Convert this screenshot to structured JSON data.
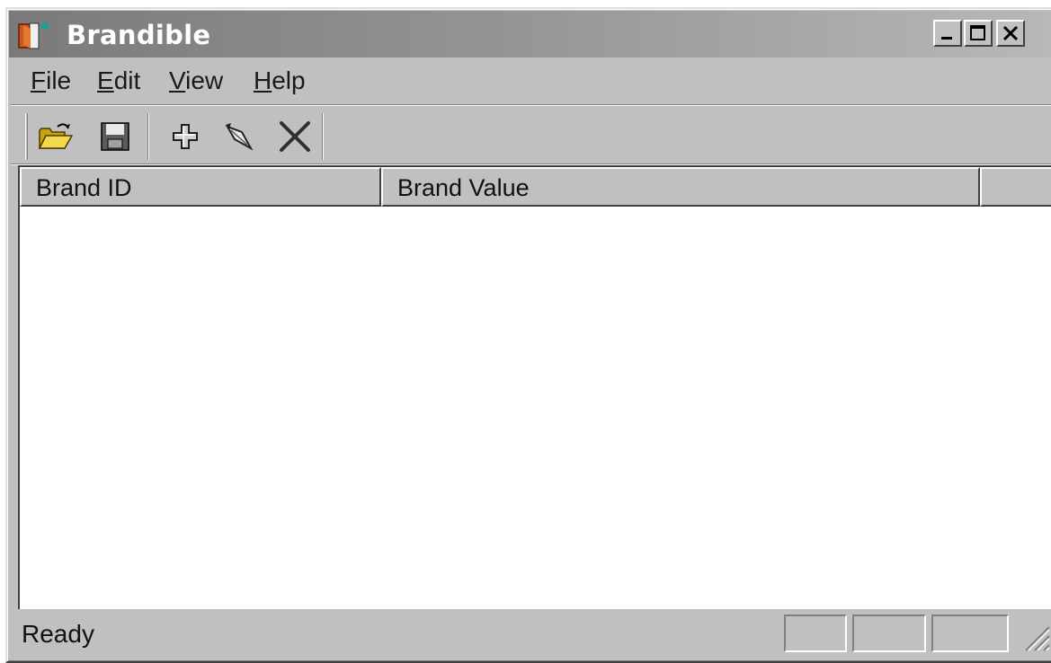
{
  "window": {
    "title": "Brandible"
  },
  "menu": {
    "items": [
      {
        "label": "File",
        "accel": "F",
        "rest": "ile"
      },
      {
        "label": "Edit",
        "accel": "E",
        "rest": "dit"
      },
      {
        "label": "View",
        "accel": "V",
        "rest": "iew"
      },
      {
        "label": "Help",
        "accel": "H",
        "rest": "elp"
      }
    ]
  },
  "toolbar": {
    "buttons": [
      {
        "name": "open-button",
        "icon": "open-folder-icon"
      },
      {
        "name": "save-button",
        "icon": "floppy-disk-icon"
      },
      {
        "name": "add-button",
        "icon": "plus-icon"
      },
      {
        "name": "edit-button",
        "icon": "pen-icon"
      },
      {
        "name": "delete-button",
        "icon": "x-delete-icon"
      }
    ]
  },
  "list": {
    "columns": [
      "Brand ID",
      "Brand Value",
      ""
    ],
    "rows": []
  },
  "status": {
    "text": "Ready"
  }
}
